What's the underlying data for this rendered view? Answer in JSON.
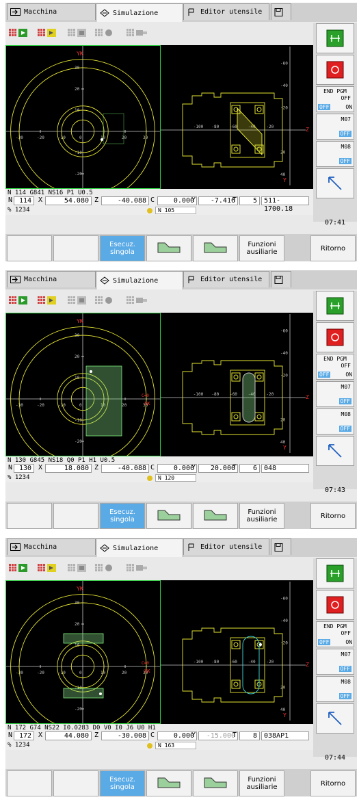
{
  "tabs": [
    "Macchina",
    "Simulazione",
    "Editor utensile"
  ],
  "panels": [
    {
      "nline": "N 114   G841 NS16 P1 U0.5",
      "n": "114",
      "x": "54.080",
      "z": "-40.088",
      "c": "0.000",
      "y": "-7.416",
      "t": "5",
      "tool": "511-1700.18",
      "scale": "% 1234",
      "nblock": "N   105",
      "clock": "07:41"
    },
    {
      "nline": "N 130   G845 NS18 Q0 P1 H1 U0.5",
      "n": "130",
      "x": "18.080",
      "z": "-40.088",
      "c": "0.000",
      "y": "20.000",
      "t": "6",
      "tool": "048",
      "scale": "% 1234",
      "nblock": "N   120",
      "clock": "07:43"
    },
    {
      "nline": "N 172   G74 NS22 I0.0283 D0 V0 I0 J6 U0 H1",
      "n": "172",
      "x": "44.080",
      "z": "-30.008",
      "c": "0.000",
      "y": "-15.000",
      "t": "8",
      "tool": "038AP1",
      "scale": "% 1234",
      "nblock": "N   163",
      "clock": "07:44"
    }
  ],
  "labels": {
    "n": "N",
    "x": "X",
    "z": "Z",
    "c": "C",
    "y": "Y",
    "t": "T",
    "yk": "YK",
    "xk": "XK",
    "y_axis": "Y",
    "z_axis": "Z",
    "c0": "C=0"
  },
  "side": {
    "end_pgm": "END PGM",
    "off": "OFF",
    "on": "ON",
    "m07": "M07",
    "m08": "M08"
  },
  "softkeys": {
    "exec": "Esecuz.\nsingola",
    "aux": "Funzioni\nausiliarie",
    "back": "Ritorno"
  },
  "left_ticks_x": [
    "-30",
    "-20",
    "-10",
    "0",
    "10",
    "20",
    "30"
  ],
  "left_ticks_y": [
    "30",
    "20",
    "10",
    "-10",
    "-20",
    "-30",
    "-40"
  ],
  "right_ticks_x": [
    "-100",
    "-80",
    "-60",
    "-40",
    "-20"
  ],
  "right_ticks_y": [
    "-60",
    "-40",
    "-20",
    "20",
    "40",
    "60"
  ],
  "colors": {
    "accent": "#5aaae6",
    "grid": "#c8c8c8",
    "part": "#e6e632",
    "green": "#2ecc40"
  }
}
